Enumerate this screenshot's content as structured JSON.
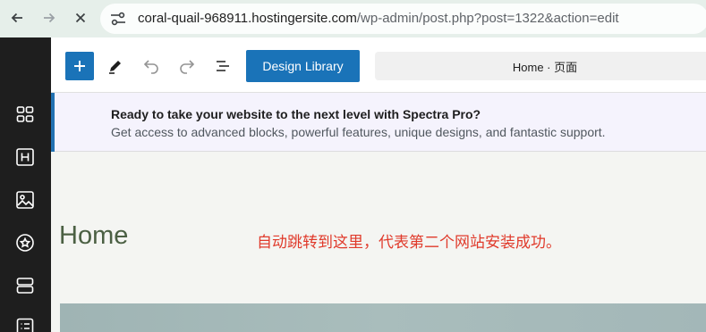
{
  "browser": {
    "url_host": "coral-quail-968911.hostingersite.com",
    "url_path": "/wp-admin/post.php?post=1322&action=edit",
    "icons": [
      "back-icon",
      "forward-icon",
      "close-icon",
      "site-info-icon"
    ]
  },
  "sidebar": {
    "icons": [
      "blocks-icon",
      "heading-icon",
      "image-icon",
      "star-icon",
      "layers-icon",
      "list-icon"
    ]
  },
  "toolbar": {
    "design_library_label": "Design Library",
    "document_title": "Home · 页面",
    "icons": [
      "plus-icon",
      "pencil-icon",
      "undo-icon",
      "redo-icon",
      "list-view-icon"
    ]
  },
  "notice": {
    "title": "Ready to take your website to the next level with Spectra Pro?",
    "text": "Get access to advanced blocks, powerful features, unique designs, and fantastic support."
  },
  "canvas": {
    "page_title": "Home",
    "annotation": "自动跳转到这里，代表第二个网站安装成功。"
  },
  "colors": {
    "accent": "#1a73b8",
    "sidebar": "#1e1e1e",
    "heading": "#4b6043",
    "annotation": "#e03a2b"
  }
}
